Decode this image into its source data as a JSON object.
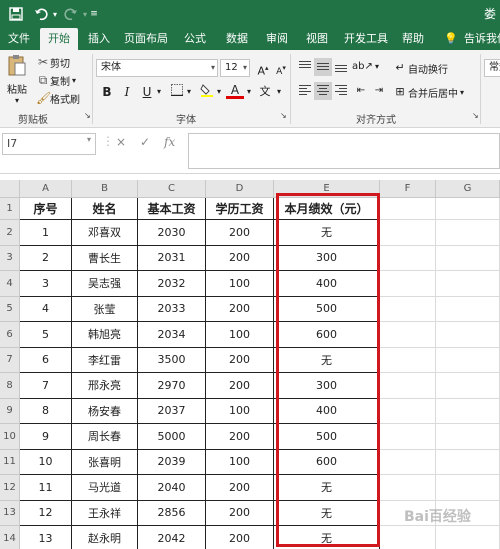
{
  "app": {
    "title": "娄",
    "accent": "#217346",
    "highlight_color": "#d0181e"
  },
  "quick_access": {
    "save_icon": "save-icon",
    "undo_icon": "undo-icon",
    "redo_icon": "redo-icon",
    "customize_icon": "customize-icon"
  },
  "tabs": [
    {
      "label": "文件",
      "active": false
    },
    {
      "label": "开始",
      "active": true
    },
    {
      "label": "插入",
      "active": false
    },
    {
      "label": "页面布局",
      "active": false
    },
    {
      "label": "公式",
      "active": false
    },
    {
      "label": "数据",
      "active": false
    },
    {
      "label": "审阅",
      "active": false
    },
    {
      "label": "视图",
      "active": false
    },
    {
      "label": "开发工具",
      "active": false
    },
    {
      "label": "帮助",
      "active": false
    }
  ],
  "tell_me": "告诉我你",
  "ribbon": {
    "clipboard": {
      "paste": "粘贴",
      "cut": "剪切",
      "copy": "复制",
      "format_painter": "格式刷",
      "group_label": "剪贴板"
    },
    "font": {
      "font_name": "宋体",
      "font_size": "12",
      "grow": "A",
      "shrink": "A",
      "bold": "B",
      "italic": "I",
      "underline": "U",
      "font_color": "A",
      "phonetic": "文",
      "group_label": "字体"
    },
    "alignment": {
      "wrap_text": "自动换行",
      "merge_center": "合并后居中",
      "group_label": "对齐方式"
    },
    "number": {
      "format": "常规"
    }
  },
  "formula_bar": {
    "cell_ref": "I7",
    "cancel": "×",
    "enter": "✓",
    "fx": "fx",
    "content": ""
  },
  "columns": [
    "A",
    "B",
    "C",
    "D",
    "E",
    "F",
    "G"
  ],
  "row_numbers": [
    "1",
    "2",
    "3",
    "4",
    "5",
    "6",
    "7",
    "8",
    "9",
    "10",
    "11",
    "12",
    "13",
    "14"
  ],
  "table": {
    "headers": [
      "序号",
      "姓名",
      "基本工资",
      "学历工资",
      "本月绩效（元）"
    ],
    "rows": [
      [
        "1",
        "邓喜双",
        "2030",
        "200",
        "无"
      ],
      [
        "2",
        "曹长生",
        "2031",
        "200",
        "300"
      ],
      [
        "3",
        "吴志强",
        "2032",
        "100",
        "400"
      ],
      [
        "4",
        "张莹",
        "2033",
        "200",
        "500"
      ],
      [
        "5",
        "韩旭亮",
        "2034",
        "100",
        "600"
      ],
      [
        "6",
        "李红雷",
        "3500",
        "200",
        "无"
      ],
      [
        "7",
        "邢永亮",
        "2970",
        "200",
        "300"
      ],
      [
        "8",
        "杨安春",
        "2037",
        "100",
        "400"
      ],
      [
        "9",
        "周长春",
        "5000",
        "200",
        "500"
      ],
      [
        "10",
        "张喜明",
        "2039",
        "100",
        "600"
      ],
      [
        "11",
        "马光道",
        "2040",
        "200",
        "无"
      ],
      [
        "12",
        "王永祥",
        "2856",
        "200",
        "无"
      ],
      [
        "13",
        "赵永明",
        "2042",
        "200",
        "无"
      ]
    ]
  },
  "watermark": "Bai百经验"
}
